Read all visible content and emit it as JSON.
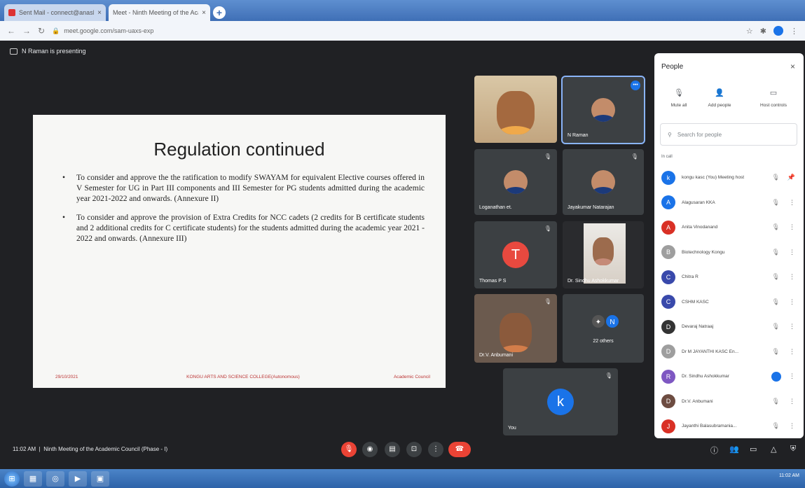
{
  "browser": {
    "tabs": [
      {
        "title": "Sent Mail - connect@anaskst.in",
        "close": "×"
      },
      {
        "title": "Meet - Ninth Meeting of the Academic Council",
        "close": "×"
      }
    ],
    "new_tab": "+",
    "url": "meet.google.com/sam-uaxs-exp"
  },
  "meet": {
    "presenting_label": "N Raman is presenting",
    "slide": {
      "title": "Regulation continued",
      "bullets": [
        "To consider and approve the the ratification to modify SWAYAM for equivalent Elective courses offered in V Semester for UG in Part III components and III Semester for PG students admitted during the academic year 2021-2022 and onwards. (Annexure II)",
        "To consider and approve the provision of Extra Credits for NCC cadets (2 credits for B certificate students and 2 additional credits for C certificate students) for the students admitted during the academic year 2021 - 2022 and onwards. (Annexure III)"
      ],
      "footer_date": "29/10/2021",
      "footer_college": "KONGU ARTS AND SCIENCE COLLEGE(Autonomous)",
      "footer_council": "Academic Council"
    },
    "tiles": [
      {
        "name": ""
      },
      {
        "name": "N Raman"
      },
      {
        "name": "Loganathan et."
      },
      {
        "name": "Jayakumar Natarajan"
      },
      {
        "name": "Thomas P S",
        "initial": "T"
      },
      {
        "name": "Dr. Sindhu Ashokkumar"
      },
      {
        "name": "Dr.V. Anbumani"
      },
      {
        "name": "22 others",
        "initial": "N"
      },
      {
        "name": "You",
        "initial": "k"
      }
    ],
    "bottom": {
      "time": "11:02 AM",
      "meeting_title": "Ninth Meeting of the Academic Council (Phase - I)"
    }
  },
  "people_panel": {
    "title": "People",
    "close": "×",
    "actions": {
      "mute_all": "Mute all",
      "add_people": "Add people",
      "host_controls": "Host controls"
    },
    "search_placeholder": "Search for people",
    "in_call": "In call",
    "participants": [
      {
        "name": "kongu kasc (You) Meeting host",
        "initial": "k",
        "color": "#1a73e8"
      },
      {
        "name": "Alagusaran KKA",
        "initial": "A",
        "color": "#1a73e8"
      },
      {
        "name": "Anita Vinodanand",
        "initial": "A",
        "color": "#d93025"
      },
      {
        "name": "Biotechnology Kongu",
        "initial": "B",
        "color": "#9e9e9e"
      },
      {
        "name": "Chitra R",
        "initial": "C",
        "color": "#3949ab"
      },
      {
        "name": "CSHM KASC",
        "initial": "C",
        "color": "#3949ab"
      },
      {
        "name": "Devaraj Natraaj",
        "initial": "D",
        "color": "#333333"
      },
      {
        "name": "Dr M JAYANTHI KASC En...",
        "initial": "D",
        "color": "#9e9e9e"
      },
      {
        "name": "Dr. Sindhu Ashokkumar",
        "initial": "R",
        "color": "#7e57c2"
      },
      {
        "name": "Dr.V. Anbumani",
        "initial": "D",
        "color": "#6d4c41"
      },
      {
        "name": "Jayanthi Balasubramania...",
        "initial": "J",
        "color": "#d93025"
      }
    ]
  },
  "taskbar": {
    "clock": "11:02 AM"
  }
}
